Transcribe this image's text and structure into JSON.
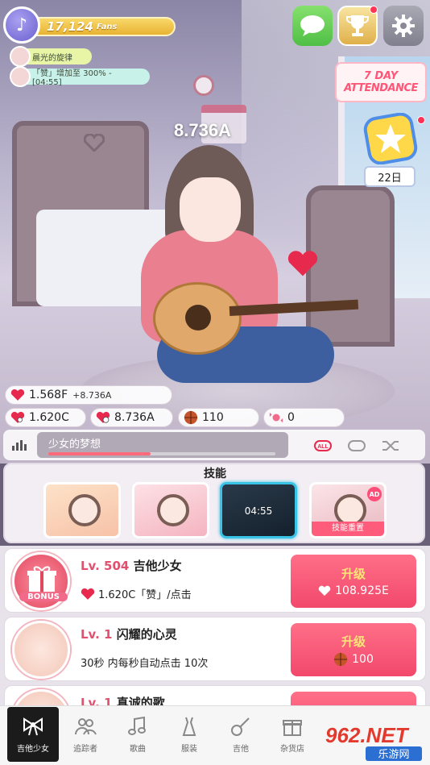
{
  "hud": {
    "fans_value": "17,124",
    "fans_label": "Fans",
    "notices": [
      "晨光的旋律",
      "「赞」增加至 300% - [04:55]"
    ],
    "rate": "8.736A"
  },
  "attendance": {
    "line1": "7 DAY",
    "line2": "ATTENDANCE"
  },
  "daily": {
    "day_label": "22日"
  },
  "stats": {
    "hearts_total": "1.568F",
    "hearts_rate": "+8.736A",
    "tap_value": "1.620C",
    "auto_value": "8.736A",
    "basketball": "110",
    "candy": "0"
  },
  "song": {
    "title": "少女的梦想",
    "progress": 0.45
  },
  "skills": {
    "title": "技能",
    "timer": "04:55",
    "ad_badge": "AD",
    "reset_label": "技能重置"
  },
  "upgrades": [
    {
      "lv_prefix": "Lv. 504",
      "name": "吉他少女",
      "desc": "1.620C「赞」/点击",
      "btn_label": "升级",
      "cost": "108.925E",
      "bonus_label": "BONUS"
    },
    {
      "lv_prefix": "Lv. 1",
      "name": "闪耀的心灵",
      "desc": "30秒 内每秒自动点击 10次",
      "btn_label": "升级",
      "cost": "100"
    },
    {
      "lv_prefix": "Lv. 1",
      "name": "真诚的歌"
    }
  ],
  "nav": [
    {
      "label": "吉他少女",
      "icon": "bow-icon"
    },
    {
      "label": "追踪者",
      "icon": "users-icon"
    },
    {
      "label": "歌曲",
      "icon": "music-note-icon"
    },
    {
      "label": "服装",
      "icon": "dress-icon"
    },
    {
      "label": "吉他",
      "icon": "guitar-icon"
    },
    {
      "label": "杂货店",
      "icon": "gift-icon"
    }
  ],
  "watermark": {
    "brand": "962.NET",
    "sub": "乐游网"
  },
  "colors": {
    "accent": "#f2486b",
    "gold": "#e8b332",
    "level": "#e34f6e"
  }
}
